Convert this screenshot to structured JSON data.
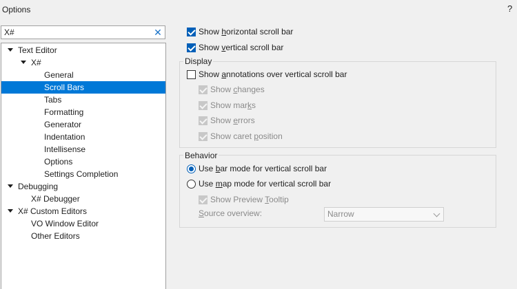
{
  "window": {
    "title": "Options",
    "help": "?"
  },
  "search": {
    "value": "X#"
  },
  "tree": [
    {
      "label": "Text Editor",
      "level": 0,
      "expandable": true,
      "expanded": true,
      "selected": false
    },
    {
      "label": "X#",
      "level": 1,
      "expandable": true,
      "expanded": true,
      "selected": false
    },
    {
      "label": "General",
      "level": 2,
      "expandable": false,
      "selected": false
    },
    {
      "label": "Scroll Bars",
      "level": 2,
      "expandable": false,
      "selected": true
    },
    {
      "label": "Tabs",
      "level": 2,
      "expandable": false,
      "selected": false
    },
    {
      "label": "Formatting",
      "level": 2,
      "expandable": false,
      "selected": false
    },
    {
      "label": "Generator",
      "level": 2,
      "expandable": false,
      "selected": false
    },
    {
      "label": "Indentation",
      "level": 2,
      "expandable": false,
      "selected": false
    },
    {
      "label": "Intellisense",
      "level": 2,
      "expandable": false,
      "selected": false
    },
    {
      "label": "Options",
      "level": 2,
      "expandable": false,
      "selected": false
    },
    {
      "label": "Settings Completion",
      "level": 2,
      "expandable": false,
      "selected": false
    },
    {
      "label": "Debugging",
      "level": 0,
      "expandable": true,
      "expanded": true,
      "selected": false
    },
    {
      "label": "X# Debugger",
      "level": 1,
      "expandable": false,
      "selected": false
    },
    {
      "label": "X# Custom Editors",
      "level": 0,
      "expandable": true,
      "expanded": true,
      "selected": false
    },
    {
      "label": "VO Window Editor",
      "level": 1,
      "expandable": false,
      "selected": false
    },
    {
      "label": "Other Editors",
      "level": 1,
      "expandable": false,
      "selected": false
    }
  ],
  "options": {
    "show_horizontal": {
      "label": "Show horizontal scroll bar",
      "checked": true
    },
    "show_vertical": {
      "label": "Show vertical scroll bar",
      "checked": true
    },
    "display": {
      "title": "Display",
      "show_annotations": {
        "label": "Show annotations over vertical scroll bar",
        "checked": false
      },
      "show_changes": {
        "label": "Show changes",
        "checked": true
      },
      "show_marks": {
        "label": "Show marks",
        "checked": true
      },
      "show_errors": {
        "label": "Show errors",
        "checked": true
      },
      "show_caret": {
        "label": "Show caret position",
        "checked": true
      }
    },
    "behavior": {
      "title": "Behavior",
      "bar_mode": {
        "label": "Use bar mode for vertical scroll bar",
        "checked": true
      },
      "map_mode": {
        "label": "Use map mode for vertical scroll bar",
        "checked": false
      },
      "preview_tooltip": {
        "label": "Show Preview Tooltip",
        "checked": true
      },
      "source_overview_label": "Source overview:",
      "source_overview_value": "Narrow"
    }
  }
}
